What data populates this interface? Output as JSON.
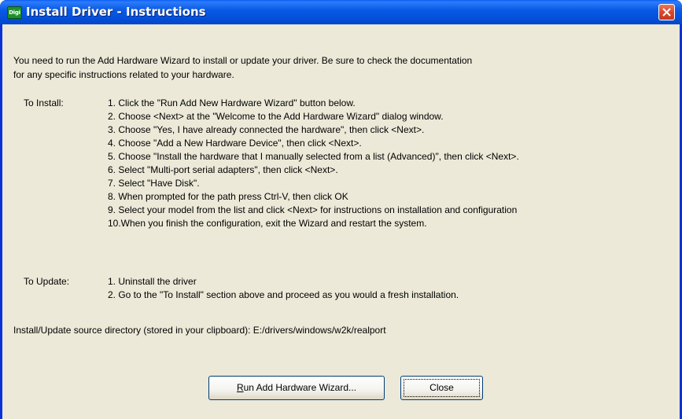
{
  "window": {
    "title": "Install Driver - Instructions",
    "icon_label": "Digi",
    "title_color": "#0a5ae6",
    "close_color": "#d9472a"
  },
  "intro": {
    "line1": "You need to run the Add Hardware Wizard to install or update your driver.  Be sure to check the documentation",
    "line2": "for any specific instructions related to your hardware."
  },
  "install": {
    "label": "To Install:",
    "steps": [
      "1. Click the \"Run Add New Hardware Wizard\" button below.",
      "2. Choose <Next> at the \"Welcome to the Add Hardware Wizard\" dialog window.",
      "3. Choose \"Yes, I have already connected the hardware\", then click <Next>.",
      "4. Choose \"Add a New Hardware Device\", then click <Next>.",
      "5. Choose \"Install the hardware that I manually selected from a list (Advanced)\", then click <Next>.",
      "6. Select \"Multi-port serial adapters\", then click <Next>.",
      "7. Select \"Have Disk\".",
      "8. When prompted for the path press Ctrl-V, then click OK",
      "9. Select your model from the list and click <Next> for instructions on installation and configuration",
      "10.When you finish the configuration, exit the Wizard and restart the system."
    ]
  },
  "update": {
    "label": "To Update:",
    "steps": [
      "1. Uninstall the driver",
      "2. Go to the \"To Install\" section above and proceed as you would a fresh installation."
    ]
  },
  "source_dir": "Install/Update source directory (stored in your clipboard): E:/drivers/windows/w2k/realport",
  "buttons": {
    "run_wizard": "Run Add Hardware Wizard...",
    "close": "Close"
  }
}
